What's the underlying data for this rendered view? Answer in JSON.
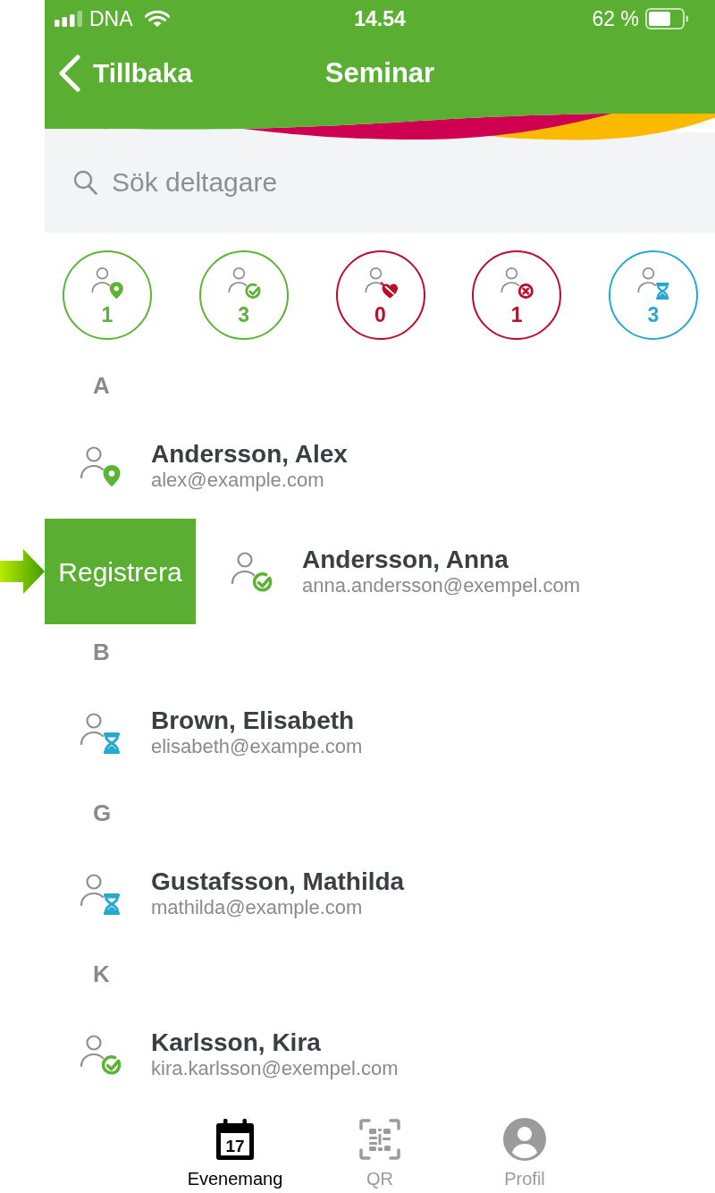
{
  "status_bar": {
    "carrier": "DNA",
    "time": "14.54",
    "battery": "62 %"
  },
  "nav_bar": {
    "back_label": "Tillbaka",
    "title": "Seminar"
  },
  "search": {
    "placeholder": "Sök deltagare"
  },
  "filters": [
    {
      "kind": "pin",
      "count": "1",
      "color": "#5cb335"
    },
    {
      "kind": "check",
      "count": "3",
      "color": "#5cb335"
    },
    {
      "kind": "slash",
      "count": "0",
      "color": "#bd0b2a"
    },
    {
      "kind": "cross",
      "count": "1",
      "color": "#bd0b2a"
    },
    {
      "kind": "hourglass",
      "count": "3",
      "color": "#27a9cf"
    }
  ],
  "sections": [
    {
      "letter": "A",
      "participants": [
        {
          "name": "Andersson, Alex",
          "email": "alex@example.com",
          "kind": "pin",
          "swiped": false
        },
        {
          "name": "Andersson, Anna",
          "email": "anna.andersson@exempel.com",
          "kind": "check",
          "swiped": true,
          "swipe_action": "Registrera"
        }
      ]
    },
    {
      "letter": "B",
      "participants": [
        {
          "name": "Brown, Elisabeth",
          "email": "elisabeth@exampe.com",
          "kind": "hourglass",
          "swiped": false
        }
      ]
    },
    {
      "letter": "G",
      "participants": [
        {
          "name": "Gustafsson, Mathilda",
          "email": "mathilda@example.com",
          "kind": "hourglass",
          "swiped": false
        }
      ]
    },
    {
      "letter": "K",
      "participants": [
        {
          "name": "Karlsson, Kira",
          "email": "kira.karlsson@exempel.com",
          "kind": "check",
          "swiped": false
        }
      ]
    }
  ],
  "tabs": [
    {
      "label": "Evenemang",
      "kind": "calendar",
      "selected": true,
      "icon_text": "17"
    },
    {
      "label": "QR",
      "kind": "qr",
      "selected": false
    },
    {
      "label": "Profil",
      "kind": "profile",
      "selected": false
    }
  ]
}
